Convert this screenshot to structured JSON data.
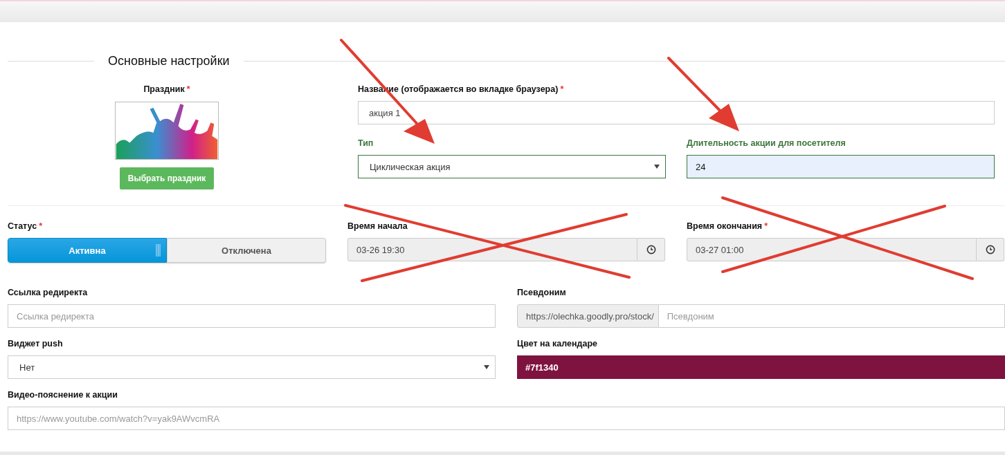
{
  "section_title": "Основные настройки",
  "holiday": {
    "label": {
      "text": "Праздник",
      "mark": "*"
    },
    "button": "Выбрать праздник"
  },
  "name_field": {
    "label": {
      "text": "Название (отображается во вкладке браузера)",
      "mark": "*"
    },
    "value": "акция 1",
    "valid": false
  },
  "type_field": {
    "label": {
      "text": "Тип"
    },
    "value": "Циклическая акция",
    "valid": true
  },
  "duration_field": {
    "label": {
      "text": "Длительность акции для посетителя"
    },
    "value": "24",
    "valid": true
  },
  "status": {
    "label": {
      "text": "Статус",
      "mark": "*"
    },
    "options": [
      {
        "label": "Активна",
        "selected": true
      },
      {
        "label": "Отключена",
        "selected": false
      }
    ]
  },
  "start_time": {
    "label": {
      "text": "Время начала"
    },
    "value": "03-26 19:30"
  },
  "end_time": {
    "label": {
      "text": "Время окончания",
      "mark": "*"
    },
    "value": "03-27 01:00"
  },
  "redirect": {
    "label": {
      "text": "Ссылка редиректа"
    },
    "placeholder": "Ссылка редиректа"
  },
  "alias": {
    "label": {
      "text": "Псевдоним"
    },
    "prefix": "https://olechka.goodly.pro/stock/",
    "placeholder": "Псевдоним"
  },
  "push_widget": {
    "label": {
      "text": "Виджет push"
    },
    "value": "Нет"
  },
  "calendar_color": {
    "label": {
      "text": "Цвет на календаре"
    },
    "value": "#7f1340",
    "color": "#7f1340"
  },
  "video": {
    "label": {
      "text": "Видео-пояснение к акции"
    },
    "placeholder": "https://www.youtube.com/watch?v=yak9AWvcmRA"
  }
}
